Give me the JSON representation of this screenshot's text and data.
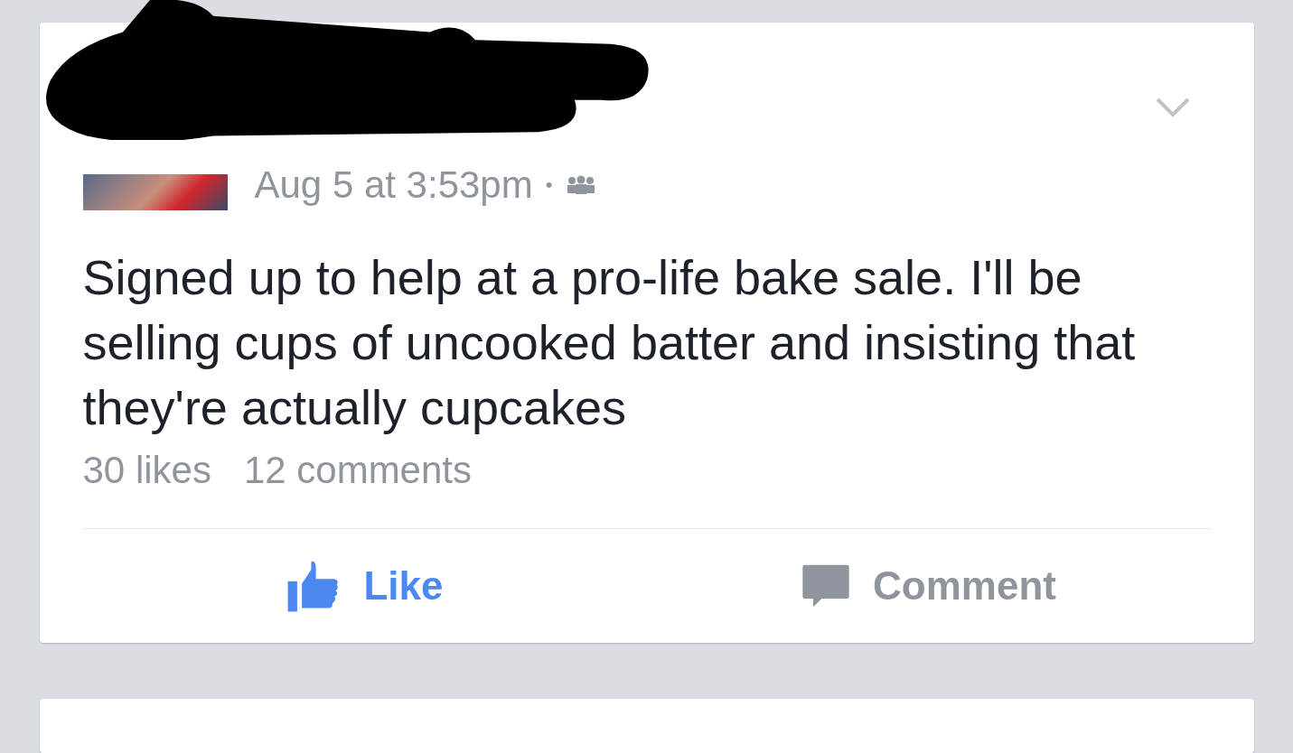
{
  "post": {
    "timestamp": "Aug 5 at 3:53pm",
    "separator": "•",
    "text": "Signed up to help at a pro-life bake sale. I'll be selling cups of uncooked batter and insisting that they're actually cupcakes",
    "likes": "30 likes",
    "comments": "12 comments"
  },
  "actions": [
    {
      "kind": "like",
      "label": "Like",
      "selected": true
    },
    {
      "kind": "comment",
      "label": "Comment",
      "selected": false
    }
  ]
}
